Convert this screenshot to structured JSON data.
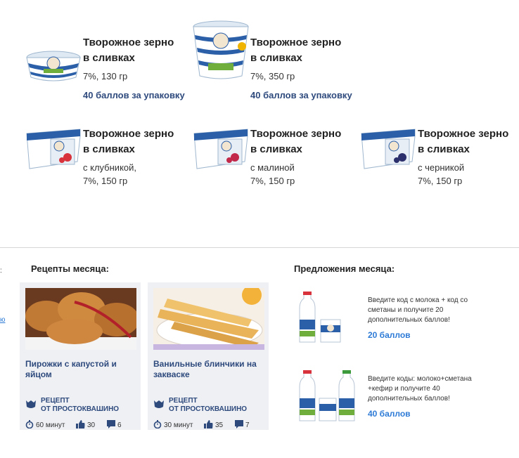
{
  "products": [
    {
      "title": "Творожное зерно\nв сливках",
      "desc": "7%, 130 гр",
      "points": "40 баллов за упаковку"
    },
    {
      "title": "Творожное зерно\nв сливках",
      "desc": "7%, 350 гр",
      "points": "40 баллов за упаковку"
    },
    {
      "title": "Творожное зерно\nв сливках",
      "desc": "с клубникой,\n7%, 150 гр",
      "points": ""
    },
    {
      "title": "Творожное зерно\nв сливках",
      "desc": "с малиной\n7%, 150 гр",
      "points": ""
    },
    {
      "title": "Творожное зерно\nв сливках",
      "desc": "с черникой\n7%, 150 гр",
      "points": ""
    }
  ],
  "left_stub": {
    "dot": ":",
    "link": "ю"
  },
  "recipes": {
    "title": "Рецепты месяца:",
    "items": [
      {
        "name": "Пирожки с капустой и\nяйцом",
        "badge": "РЕЦЕПТ\nОТ ПРОСТОКВАШИНО",
        "time": "60 минут",
        "likes": "30",
        "comments": "6"
      },
      {
        "name": "Ванильные блинчики на\nзакваске",
        "badge": "РЕЦЕПТ\nОТ ПРОСТОКВАШИНО",
        "time": "30 минут",
        "likes": "35",
        "comments": "7"
      }
    ]
  },
  "offers": {
    "title": "Предложения месяца:",
    "items": [
      {
        "text": "Введите код с молока + код со сметаны и получите 20 дополнительных баллов!",
        "points": "20 баллов"
      },
      {
        "text": "Введите коды: молоко+сметана +кефир и получите 40 дополнительных баллов!",
        "points": "40 баллов"
      }
    ]
  },
  "colors": {
    "brand_blue": "#2e4a7d",
    "link_blue": "#2d7bd6",
    "card_bg": "#eef0f4"
  }
}
